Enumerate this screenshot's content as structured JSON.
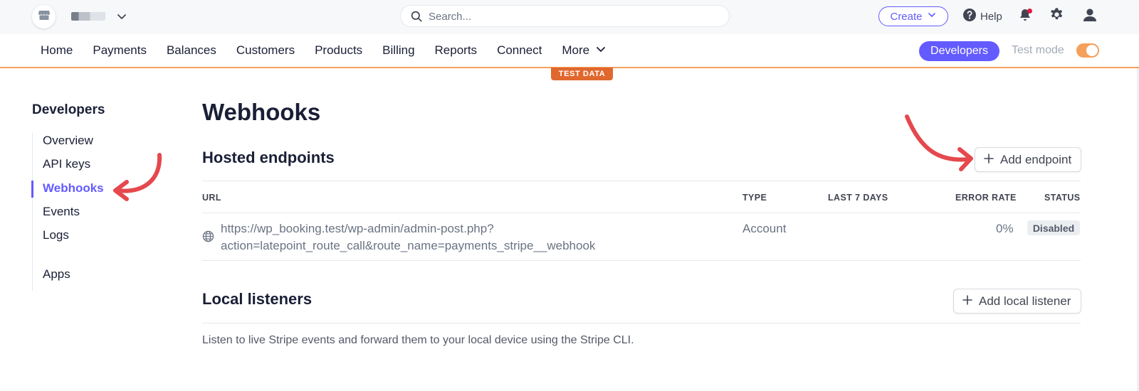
{
  "topbar": {
    "search": {
      "placeholder": "Search..."
    },
    "create_label": "Create",
    "help_label": "Help"
  },
  "nav": {
    "items": [
      "Home",
      "Payments",
      "Balances",
      "Customers",
      "Products",
      "Billing",
      "Reports",
      "Connect",
      "More"
    ],
    "developers_label": "Developers",
    "test_mode_label": "Test mode",
    "test_mode_on": true,
    "test_data_badge": "TEST DATA"
  },
  "sidebar": {
    "title": "Developers",
    "items": [
      {
        "label": "Overview"
      },
      {
        "label": "API keys"
      },
      {
        "label": "Webhooks",
        "active": true
      },
      {
        "label": "Events"
      },
      {
        "label": "Logs"
      },
      {
        "label": "Apps"
      }
    ]
  },
  "main": {
    "title": "Webhooks",
    "hosted": {
      "title": "Hosted endpoints",
      "add_label": "Add endpoint",
      "columns": [
        "URL",
        "TYPE",
        "LAST 7 DAYS",
        "ERROR RATE",
        "STATUS"
      ],
      "rows": [
        {
          "url_line1": "https://wp_booking.test/wp-admin/admin-post.php?",
          "url_line2": "action=latepoint_route_call&route_name=payments_stripe__webhook",
          "type": "Account",
          "last_7_days": "",
          "error_rate": "0%",
          "status": "Disabled"
        }
      ]
    },
    "local": {
      "title": "Local listeners",
      "add_label": "Add local listener",
      "description": "Listen to live Stripe events and forward them to your local device using the Stripe CLI."
    }
  },
  "colors": {
    "accent": "#635bff",
    "test_orange": "#e0672d",
    "annotation_arrow": "#e5484d"
  },
  "icons": [
    "store-icon",
    "chevron-down-icon",
    "search-icon",
    "help-icon",
    "bell-icon",
    "gear-icon",
    "user-icon",
    "plus-icon",
    "globe-icon"
  ]
}
